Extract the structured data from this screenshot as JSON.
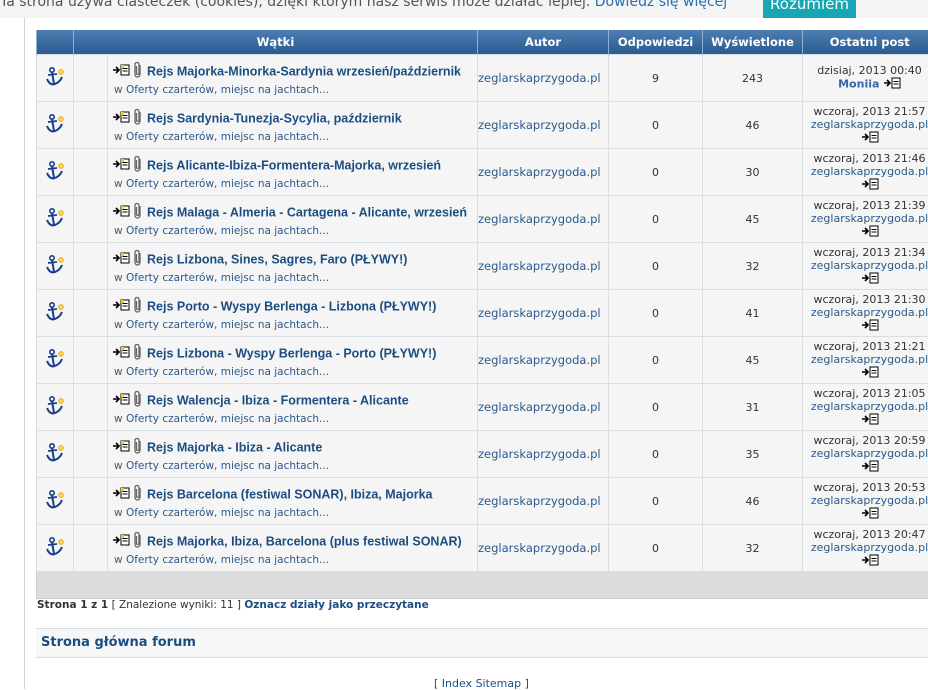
{
  "cookie": {
    "text": "Ta strona używa ciasteczek (cookies), dzięki którym nasz serwis może działać lepiej.",
    "link": "Dowiedz się więcej",
    "button": "Rozumiem"
  },
  "table": {
    "headers": [
      "Wątki",
      "Autor",
      "Odpowiedzi",
      "Wyświetlone",
      "Ostatni post"
    ],
    "rows": [
      {
        "title": "Rejs Majorka-Minorka-Sardynia wrzesień/październik",
        "forum_prefix": "w",
        "forum": "Oferty czarterów, miejsc na jachtach...",
        "author": "zeglarskaprzygoda.pl",
        "replies": "9",
        "views": "243",
        "last_date": "dzisiaj, 2013 00:40",
        "last_user": "Moniia"
      },
      {
        "title": "Rejs Sardynia-Tunezja-Sycylia, październik",
        "forum_prefix": "w",
        "forum": "Oferty czarterów, miejsc na jachtach...",
        "author": "zeglarskaprzygoda.pl",
        "replies": "0",
        "views": "46",
        "last_date": "wczoraj, 2013 21:57",
        "last_user": "zeglarskaprzygoda.pl"
      },
      {
        "title": "Rejs Alicante-Ibiza-Formentera-Majorka, wrzesień",
        "forum_prefix": "w",
        "forum": "Oferty czarterów, miejsc na jachtach...",
        "author": "zeglarskaprzygoda.pl",
        "replies": "0",
        "views": "30",
        "last_date": "wczoraj, 2013 21:46",
        "last_user": "zeglarskaprzygoda.pl"
      },
      {
        "title": "Rejs Malaga - Almeria - Cartagena - Alicante, wrzesień",
        "forum_prefix": "w",
        "forum": "Oferty czarterów, miejsc na jachtach...",
        "author": "zeglarskaprzygoda.pl",
        "replies": "0",
        "views": "45",
        "last_date": "wczoraj, 2013 21:39",
        "last_user": "zeglarskaprzygoda.pl"
      },
      {
        "title": "Rejs Lizbona, Sines, Sagres, Faro (PŁYWY!)",
        "forum_prefix": "w",
        "forum": "Oferty czarterów, miejsc na jachtach...",
        "author": "zeglarskaprzygoda.pl",
        "replies": "0",
        "views": "32",
        "last_date": "wczoraj, 2013 21:34",
        "last_user": "zeglarskaprzygoda.pl"
      },
      {
        "title": "Rejs Porto - Wyspy Berlenga - Lizbona (PŁYWY!)",
        "forum_prefix": "w",
        "forum": "Oferty czarterów, miejsc na jachtach...",
        "author": "zeglarskaprzygoda.pl",
        "replies": "0",
        "views": "41",
        "last_date": "wczoraj, 2013 21:30",
        "last_user": "zeglarskaprzygoda.pl"
      },
      {
        "title": "Rejs Lizbona - Wyspy Berlenga - Porto (PŁYWY!)",
        "forum_prefix": "w",
        "forum": "Oferty czarterów, miejsc na jachtach...",
        "author": "zeglarskaprzygoda.pl",
        "replies": "0",
        "views": "45",
        "last_date": "wczoraj, 2013 21:21",
        "last_user": "zeglarskaprzygoda.pl"
      },
      {
        "title": "Rejs Walencja - Ibiza - Formentera - Alicante",
        "forum_prefix": "w",
        "forum": "Oferty czarterów, miejsc na jachtach...",
        "author": "zeglarskaprzygoda.pl",
        "replies": "0",
        "views": "31",
        "last_date": "wczoraj, 2013 21:05",
        "last_user": "zeglarskaprzygoda.pl"
      },
      {
        "title": "Rejs Majorka - Ibiza - Alicante",
        "forum_prefix": "w",
        "forum": "Oferty czarterów, miejsc na jachtach...",
        "author": "zeglarskaprzygoda.pl",
        "replies": "0",
        "views": "35",
        "last_date": "wczoraj, 2013 20:59",
        "last_user": "zeglarskaprzygoda.pl"
      },
      {
        "title": "Rejs Barcelona (festiwal SONAR), Ibiza, Majorka",
        "forum_prefix": "w",
        "forum": "Oferty czarterów, miejsc na jachtach...",
        "author": "zeglarskaprzygoda.pl",
        "replies": "0",
        "views": "46",
        "last_date": "wczoraj, 2013 20:53",
        "last_user": "zeglarskaprzygoda.pl"
      },
      {
        "title": "Rejs Majorka, Ibiza, Barcelona (plus festiwal SONAR)",
        "forum_prefix": "w",
        "forum": "Oferty czarterów, miejsc na jachtach...",
        "author": "zeglarskaprzygoda.pl",
        "replies": "0",
        "views": "32",
        "last_date": "wczoraj, 2013 20:47",
        "last_user": "zeglarskaprzygoda.pl"
      }
    ]
  },
  "pagination": {
    "page_label": "Strona 1 z 1",
    "results": "[ Znalezione wyniki: 11 ]",
    "mark_read": "Oznacz działy jako przeczytane"
  },
  "nav": {
    "home": "Strona główna forum"
  },
  "footer": {
    "links": "[ Index Sitemap ]"
  },
  "icons": {
    "topic_icon": "anchor-icon",
    "new_post": "new-post-icon",
    "attachment": "paperclip-icon",
    "goto_last": "goto-last-post-icon"
  },
  "colors": {
    "header": "#3a6a9e",
    "link": "#1c4d82",
    "cookie_button": "#17a6b3"
  }
}
